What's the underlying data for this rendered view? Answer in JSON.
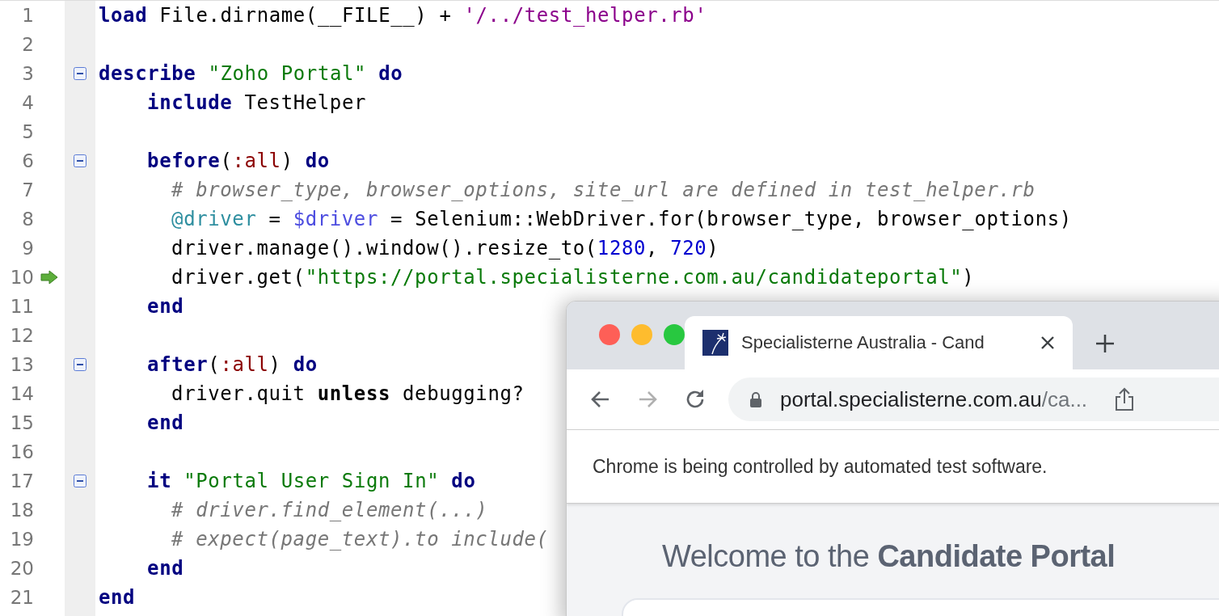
{
  "editor": {
    "lines": [
      {
        "number": "1",
        "fold_marker": false,
        "current": false,
        "tokens": [
          {
            "kind": "kw",
            "text": "load "
          },
          {
            "kind": "plain",
            "text": "File.dirname(__FILE__) + "
          },
          {
            "kind": "sstr",
            "text": "'/../test_helper.rb'"
          }
        ]
      },
      {
        "number": "2",
        "fold_marker": false,
        "current": false
      },
      {
        "number": "3",
        "fold_marker": true,
        "current": false,
        "tokens": [
          {
            "kind": "kw",
            "text": "describe "
          },
          {
            "kind": "str",
            "text": "\"Zoho Portal\" "
          },
          {
            "kind": "kw",
            "text": "do"
          }
        ],
        "children": [
          {
            "number": "4",
            "fold_marker": false,
            "current": false,
            "tokens": [
              {
                "kind": "kw",
                "text": "include "
              },
              {
                "kind": "plain",
                "text": "TestHelper"
              }
            ]
          },
          {
            "number": "5",
            "fold_marker": false,
            "current": false
          },
          {
            "number": "6",
            "fold_marker": true,
            "current": false,
            "tokens": [
              {
                "kind": "kw",
                "text": "before"
              },
              {
                "kind": "plain",
                "text": "("
              },
              {
                "kind": "sym",
                "text": ":all"
              },
              {
                "kind": "plain",
                "text": ") "
              },
              {
                "kind": "kw",
                "text": "do"
              }
            ],
            "children": [
              {
                "number": "7",
                "fold_marker": false,
                "current": false,
                "tokens": [
                  {
                    "kind": "comment",
                    "text": "# browser_type, browser_options, site_url are defined in test_helper.rb"
                  }
                ]
              },
              {
                "number": "8",
                "fold_marker": false,
                "current": false,
                "tokens": [
                  {
                    "kind": "ivar",
                    "text": "@driver "
                  },
                  {
                    "kind": "plain",
                    "text": "= "
                  },
                  {
                    "kind": "gvar",
                    "text": "$driver "
                  },
                  {
                    "kind": "plain",
                    "text": "= Selenium::WebDriver.for(browser_type, browser_options)"
                  }
                ]
              },
              {
                "number": "9",
                "fold_marker": false,
                "current": false,
                "tokens": [
                  {
                    "kind": "plain",
                    "text": "driver.manage().window().resize_to("
                  },
                  {
                    "kind": "num",
                    "text": "1280"
                  },
                  {
                    "kind": "plain",
                    "text": ", "
                  },
                  {
                    "kind": "num",
                    "text": "720"
                  },
                  {
                    "kind": "plain",
                    "text": ")"
                  }
                ]
              },
              {
                "number": "10",
                "fold_marker": false,
                "current": true,
                "tokens": [
                  {
                    "kind": "plain",
                    "text": "driver.get("
                  },
                  {
                    "kind": "str",
                    "text": "\"https://portal.specialisterne.com.au/candidateportal\""
                  },
                  {
                    "kind": "plain",
                    "text": ")"
                  }
                ]
              }
            ]
          },
          {
            "number": "11",
            "fold_marker": false,
            "current": false,
            "tokens": [
              {
                "kind": "kw",
                "text": "end"
              }
            ]
          },
          {
            "number": "12",
            "fold_marker": false,
            "current": false
          },
          {
            "number": "13",
            "fold_marker": true,
            "current": false,
            "tokens": [
              {
                "kind": "kw",
                "text": "after"
              },
              {
                "kind": "plain",
                "text": "("
              },
              {
                "kind": "sym",
                "text": ":all"
              },
              {
                "kind": "plain",
                "text": ") "
              },
              {
                "kind": "kw",
                "text": "do"
              }
            ],
            "children": [
              {
                "number": "14",
                "fold_marker": false,
                "current": false,
                "tokens": [
                  {
                    "kind": "plain",
                    "text": "driver.quit "
                  },
                  {
                    "kind": "strong",
                    "text": "unless "
                  },
                  {
                    "kind": "plain",
                    "text": "debugging?"
                  }
                ]
              }
            ]
          },
          {
            "number": "15",
            "fold_marker": false,
            "current": false,
            "tokens": [
              {
                "kind": "kw",
                "text": "end"
              }
            ]
          },
          {
            "number": "16",
            "fold_marker": false,
            "current": false
          },
          {
            "number": "17",
            "fold_marker": true,
            "current": false,
            "tokens": [
              {
                "kind": "kw",
                "text": "it "
              },
              {
                "kind": "str",
                "text": "\"Portal User Sign In\" "
              },
              {
                "kind": "kw",
                "text": "do"
              }
            ],
            "children": [
              {
                "number": "18",
                "fold_marker": false,
                "current": false,
                "tokens": [
                  {
                    "kind": "comment",
                    "text": "# driver.find_element(...)"
                  }
                ]
              },
              {
                "number": "19",
                "fold_marker": false,
                "current": false,
                "tokens": [
                  {
                    "kind": "comment",
                    "text": "# expect(page_text).to include("
                  }
                ]
              }
            ]
          },
          {
            "number": "20",
            "fold_marker": false,
            "current": false,
            "tokens": [
              {
                "kind": "kw",
                "text": "end"
              }
            ]
          }
        ]
      },
      {
        "number": "21",
        "fold_marker": false,
        "current": false,
        "tokens": [
          {
            "kind": "kw",
            "text": "end"
          }
        ]
      }
    ]
  },
  "browser": {
    "tabs": [
      {
        "title": "Specialisterne Australia - Cand",
        "selected": true
      }
    ],
    "nav_buttons": [
      {
        "kind": "back",
        "disabled": false
      },
      {
        "kind": "forward",
        "disabled": true
      },
      {
        "kind": "reload",
        "disabled": false
      }
    ],
    "address": {
      "host": "portal.specialisterne.com.au",
      "path": "/ca..."
    },
    "infobar": "Chrome is being controlled by automated test software.",
    "page": {
      "heading": "Welcome to the **Candidate Portal**"
    }
  }
}
